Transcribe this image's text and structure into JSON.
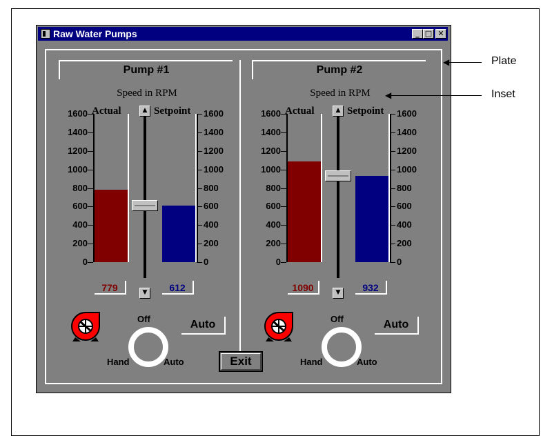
{
  "window": {
    "title": "Raw Water Pumps",
    "controls": [
      "_",
      "□",
      "✕"
    ]
  },
  "annotations": {
    "plate": "Plate",
    "inset": "Inset"
  },
  "scale_ticks": [
    "1600",
    "1400",
    "1200",
    "1000",
    "800",
    "600",
    "400",
    "200",
    "0"
  ],
  "scale_max": 1600,
  "colors": {
    "actual": "#800000",
    "setpoint": "#000080",
    "window_bg": "#808080"
  },
  "pumps": [
    {
      "title": "Pump #1",
      "speed_label": "Speed in RPM",
      "actual_label": "Actual",
      "setpoint_label": "Setpoint",
      "actual_value": "779",
      "setpoint_value": "612",
      "actual_rpm": 779,
      "setpoint_rpm": 612,
      "slider_rpm": 612,
      "switch": {
        "off": "Off",
        "hand": "Hand",
        "auto": "Auto"
      },
      "mode_button": "Auto"
    },
    {
      "title": "Pump #2",
      "speed_label": "Speed in RPM",
      "actual_label": "Actual",
      "setpoint_label": "Setpoint",
      "actual_value": "1090",
      "setpoint_value": "932",
      "actual_rpm": 1090,
      "setpoint_rpm": 932,
      "slider_rpm": 932,
      "switch": {
        "off": "Off",
        "hand": "Hand",
        "auto": "Auto"
      },
      "mode_button": "Auto"
    }
  ],
  "exit_label": "Exit"
}
